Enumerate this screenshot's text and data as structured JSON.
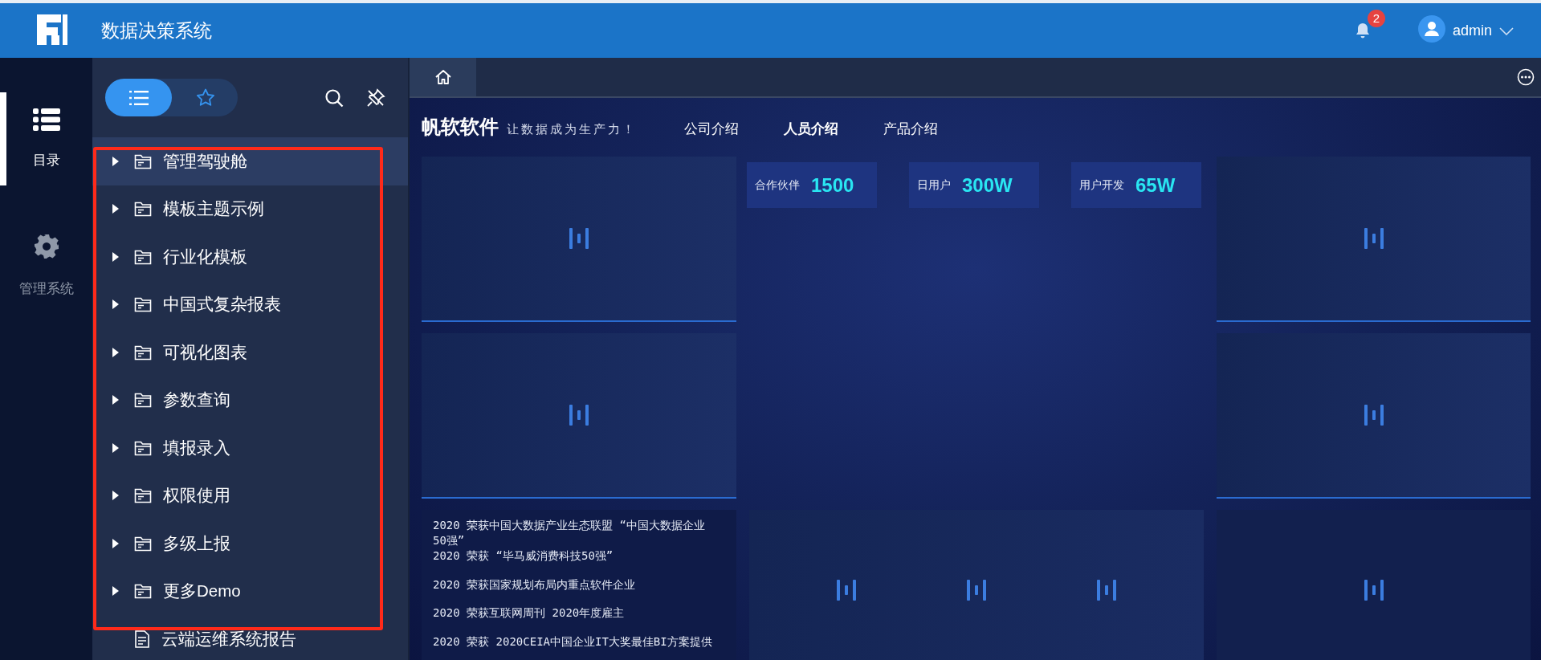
{
  "header": {
    "title": "数据决策系统",
    "notification_count": "2",
    "user": "admin"
  },
  "rail": [
    {
      "kind": "catalog",
      "label": "目录",
      "selected": true
    },
    {
      "kind": "settings",
      "label": "管理系统",
      "selected": false
    }
  ],
  "sidebar": {
    "view_toggle": [
      {
        "kind": "list",
        "selected": true
      },
      {
        "kind": "favorites",
        "selected": false
      }
    ],
    "tree": [
      {
        "kind": "folder",
        "label": "管理驾驶舱",
        "expanded": false,
        "selected": true
      },
      {
        "kind": "folder",
        "label": "模板主题示例",
        "expanded": false,
        "selected": false
      },
      {
        "kind": "folder",
        "label": "行业化模板",
        "expanded": false,
        "selected": false
      },
      {
        "kind": "folder",
        "label": "中国式复杂报表",
        "expanded": false,
        "selected": false
      },
      {
        "kind": "folder",
        "label": "可视化图表",
        "expanded": false,
        "selected": false
      },
      {
        "kind": "folder",
        "label": "参数查询",
        "expanded": false,
        "selected": false
      },
      {
        "kind": "folder",
        "label": "填报录入",
        "expanded": false,
        "selected": false
      },
      {
        "kind": "folder",
        "label": "权限使用",
        "expanded": false,
        "selected": false
      },
      {
        "kind": "folder",
        "label": "多级上报",
        "expanded": false,
        "selected": false
      },
      {
        "kind": "folder",
        "label": "更多Demo",
        "expanded": false,
        "selected": false
      },
      {
        "kind": "report",
        "label": "云端运维系统报告",
        "selected": false
      }
    ]
  },
  "annotation": {
    "kind": "rectangle",
    "color": "#ff2a1a"
  },
  "tabs": [
    {
      "kind": "home",
      "selected": true
    }
  ],
  "dashboard": {
    "brand": "帆软软件",
    "slogan": "让数据成为生产力！",
    "nav": [
      {
        "label": "公司介绍",
        "selected": false
      },
      {
        "label": "人员介绍",
        "selected": true
      },
      {
        "label": "产品介绍",
        "selected": false
      }
    ],
    "stats": [
      {
        "label": "合作伙伴",
        "value": "1500"
      },
      {
        "label": "日用户",
        "value": "300W"
      },
      {
        "label": "用户开发",
        "value": "65W"
      }
    ],
    "news": [
      "2020 荣获中国大数据产业生态联盟 “中国大数据企业50强”",
      "2020 荣获 “毕马威消费科技50强”",
      "2020 荣获国家规划布局内重点软件企业",
      "2020 荣获互联网周刊 2020年度雇主",
      "2020 荣获 2020CEIA中国企业IT大奖最佳BI方案提供"
    ]
  }
}
